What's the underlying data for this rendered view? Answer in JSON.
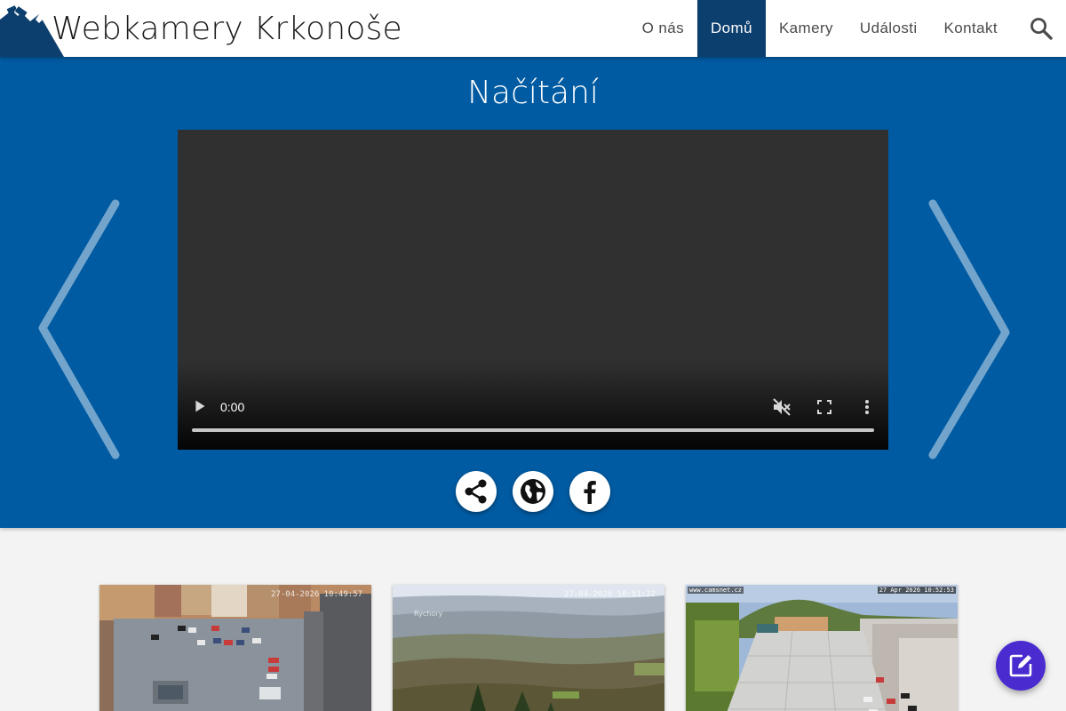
{
  "header": {
    "title": "Webkamery Krkonoše",
    "nav": [
      {
        "label": "O nás",
        "active": false
      },
      {
        "label": "Domů",
        "active": true
      },
      {
        "label": "Kamery",
        "active": false
      },
      {
        "label": "Události",
        "active": false
      },
      {
        "label": "Kontakt",
        "active": false
      }
    ],
    "search_icon": "search-icon"
  },
  "hero": {
    "title": "Načítání",
    "player": {
      "current_time": "0:00",
      "icons": [
        "play-icon",
        "volume-off-icon",
        "fullscreen-icon",
        "more-vert-icon"
      ]
    },
    "share_buttons": [
      "share-icon",
      "globe-icon",
      "facebook-icon"
    ]
  },
  "cameras": [
    {
      "timestamp": "27-04-2026 10:49:57"
    },
    {
      "timestamp": "27-04-2026 10:51:22",
      "label": "Rychory"
    },
    {
      "watermark": "www.camsnet.cz",
      "timestamp": "27 Apr 2026 10:52:53"
    }
  ],
  "colors": {
    "brand_blue": "#005ba2",
    "nav_active": "#0d3f6e",
    "fab": "#4a2bd0"
  }
}
